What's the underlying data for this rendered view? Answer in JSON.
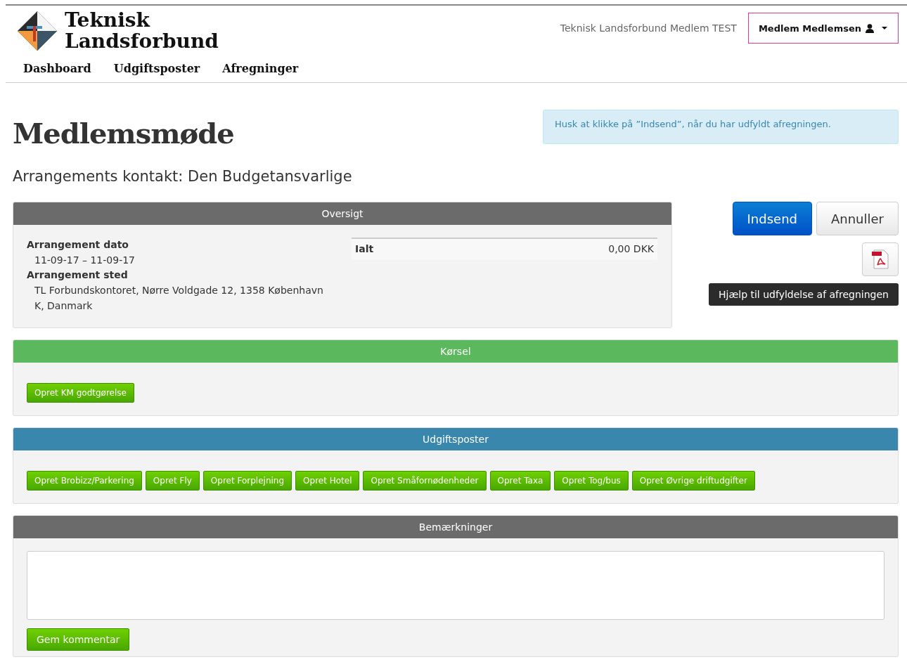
{
  "header": {
    "logo_lines": [
      "Teknisk",
      "Landsforbund"
    ],
    "nav": [
      "Dashboard",
      "Udgiftsposter",
      "Afregninger"
    ],
    "site_label": "Teknisk Landsforbund Medlem TEST",
    "user_menu": "Medlem Medlemsen"
  },
  "page": {
    "title": "Medlemsmøde",
    "alert": "Husk at klikke på ”Indsend”, når du har udfyldt afregningen.",
    "contact": "Arrangements kontakt: Den Budgetansvarlige"
  },
  "overview": {
    "title": "Oversigt",
    "details": [
      {
        "label": "Arrangement dato",
        "value": "11-09-17 – 11-09-17"
      },
      {
        "label": "Arrangement sted",
        "value": "TL Forbundskontoret, Nørre Voldgade 12, 1358 København K, Danmark"
      }
    ],
    "total": {
      "label": "Ialt",
      "value": "0,00 DKK"
    }
  },
  "actions": {
    "submit": "Indsend",
    "cancel": "Annuller",
    "help": "Hjælp til udfyldelse af afregningen"
  },
  "panels": [
    {
      "title": "Kørsel",
      "color": "#5cb85c",
      "kind": "buttons",
      "buttons": [
        "Opret KM godtgørelse"
      ]
    },
    {
      "title": "Udgiftsposter",
      "color": "#3a87ad",
      "kind": "buttons",
      "buttons": [
        "Opret Brobizz/Parkering",
        "Opret Fly",
        "Opret Forplejning",
        "Opret Hotel",
        "Opret Småfornødenheder",
        "Opret Taxa",
        "Opret Tog/bus",
        "Opret Øvrige driftudgifter"
      ]
    },
    {
      "title": "Bemærkninger",
      "color": "#6b6b6b",
      "kind": "comment",
      "save": "Gem kommentar"
    }
  ]
}
